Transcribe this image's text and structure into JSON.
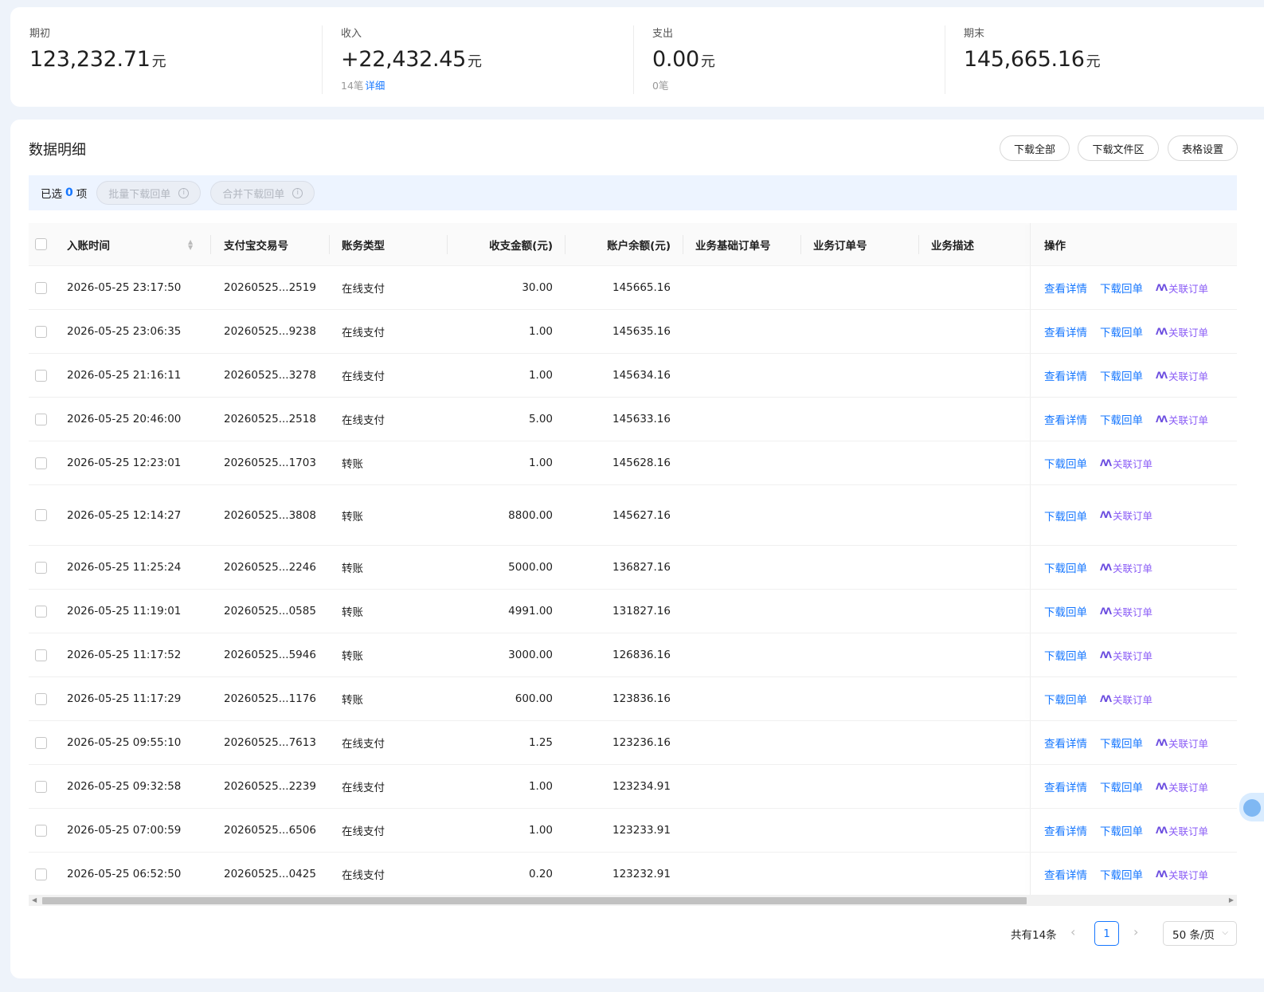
{
  "summary": [
    {
      "label": "期初",
      "value": "123,232.71",
      "unit": "元",
      "sub_count": "",
      "sub_link": ""
    },
    {
      "label": "收入",
      "value": "+22,432.45",
      "unit": "元",
      "sub_count": "14笔",
      "sub_link": "详细"
    },
    {
      "label": "支出",
      "value": "0.00",
      "unit": "元",
      "sub_count": "0笔",
      "sub_link": ""
    },
    {
      "label": "期末",
      "value": "145,665.16",
      "unit": "元",
      "sub_count": "",
      "sub_link": ""
    }
  ],
  "section": {
    "title": "数据明细",
    "buttons": [
      "下载全部",
      "下载文件区",
      "表格设置"
    ]
  },
  "selection": {
    "prefix": "已选",
    "count": "0",
    "suffix": "项",
    "batch_download": "批量下载回单",
    "merge_download": "合并下载回单"
  },
  "table": {
    "headers": {
      "time": "入账时间",
      "trade_no": "支付宝交易号",
      "type": "账务类型",
      "amount": "收支金额(元)",
      "balance": "账户余额(元)",
      "base_order": "业务基础订单号",
      "order": "业务订单号",
      "desc": "业务描述",
      "ops": "操作"
    },
    "ops_labels": {
      "detail": "查看详情",
      "download": "下载回单",
      "link": "关联订单"
    },
    "rows": [
      {
        "time": "2026-05-25 23:17:50",
        "trade_no": "20260525...2519",
        "type": "在线支付",
        "amount": "30.00",
        "balance": "145665.16",
        "detail": true
      },
      {
        "time": "2026-05-25 23:06:35",
        "trade_no": "20260525...9238",
        "type": "在线支付",
        "amount": "1.00",
        "balance": "145635.16",
        "detail": true
      },
      {
        "time": "2026-05-25 21:16:11",
        "trade_no": "20260525...3278",
        "type": "在线支付",
        "amount": "1.00",
        "balance": "145634.16",
        "detail": true
      },
      {
        "time": "2026-05-25 20:46:00",
        "trade_no": "20260525...2518",
        "type": "在线支付",
        "amount": "5.00",
        "balance": "145633.16",
        "detail": true
      },
      {
        "time": "2026-05-25 12:23:01",
        "trade_no": "20260525...1703",
        "type": "转账",
        "amount": "1.00",
        "balance": "145628.16",
        "detail": false
      },
      {
        "time": "2026-05-25 12:14:27",
        "trade_no": "20260525...3808",
        "type": "转账",
        "amount": "8800.00",
        "balance": "145627.16",
        "detail": false
      },
      {
        "time": "2026-05-25 11:25:24",
        "trade_no": "20260525...2246",
        "type": "转账",
        "amount": "5000.00",
        "balance": "136827.16",
        "detail": false
      },
      {
        "time": "2026-05-25 11:19:01",
        "trade_no": "20260525...0585",
        "type": "转账",
        "amount": "4991.00",
        "balance": "131827.16",
        "detail": false
      },
      {
        "time": "2026-05-25 11:17:52",
        "trade_no": "20260525...5946",
        "type": "转账",
        "amount": "3000.00",
        "balance": "126836.16",
        "detail": false
      },
      {
        "time": "2026-05-25 11:17:29",
        "trade_no": "20260525...1176",
        "type": "转账",
        "amount": "600.00",
        "balance": "123836.16",
        "detail": false
      },
      {
        "time": "2026-05-25 09:55:10",
        "trade_no": "20260525...7613",
        "type": "在线支付",
        "amount": "1.25",
        "balance": "123236.16",
        "detail": true
      },
      {
        "time": "2026-05-25 09:32:58",
        "trade_no": "20260525...2239",
        "type": "在线支付",
        "amount": "1.00",
        "balance": "123234.91",
        "detail": true
      },
      {
        "time": "2026-05-25 07:00:59",
        "trade_no": "20260525...6506",
        "type": "在线支付",
        "amount": "1.00",
        "balance": "123233.91",
        "detail": true
      },
      {
        "time": "2026-05-25 06:52:50",
        "trade_no": "20260525...0425",
        "type": "在线支付",
        "amount": "0.20",
        "balance": "123232.91",
        "detail": true
      }
    ]
  },
  "pagination": {
    "total": "共有14条",
    "current": "1",
    "page_size": "50 条/页"
  },
  "colors": {
    "accent": "#1677ff",
    "link_purple": "#8a5cf6"
  }
}
